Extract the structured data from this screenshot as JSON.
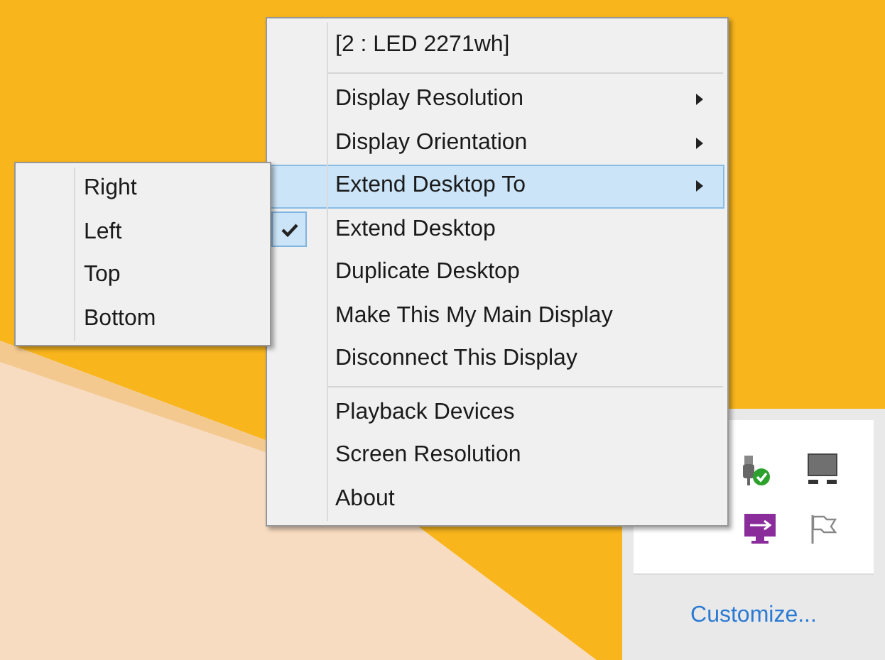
{
  "menu": {
    "header": "[2 : LED 2271wh]",
    "groups": [
      [
        {
          "label": "Display Resolution",
          "submenu": true,
          "selected": false,
          "checked": false
        },
        {
          "label": "Display Orientation",
          "submenu": true,
          "selected": false,
          "checked": false
        },
        {
          "label": "Extend Desktop To",
          "submenu": true,
          "selected": true,
          "checked": false
        },
        {
          "label": "Extend Desktop",
          "submenu": false,
          "selected": false,
          "checked": true
        },
        {
          "label": "Duplicate Desktop",
          "submenu": false,
          "selected": false,
          "checked": false
        },
        {
          "label": "Make This My Main Display",
          "submenu": false,
          "selected": false,
          "checked": false
        },
        {
          "label": "Disconnect This Display",
          "submenu": false,
          "selected": false,
          "checked": false
        }
      ],
      [
        {
          "label": "Playback Devices",
          "submenu": false,
          "selected": false,
          "checked": false
        },
        {
          "label": "Screen Resolution",
          "submenu": false,
          "selected": false,
          "checked": false
        },
        {
          "label": "About",
          "submenu": false,
          "selected": false,
          "checked": false
        }
      ]
    ]
  },
  "submenu": {
    "items": [
      {
        "label": "Right"
      },
      {
        "label": "Left"
      },
      {
        "label": "Top"
      },
      {
        "label": "Bottom"
      }
    ]
  },
  "tray": {
    "link": "Customize..."
  }
}
